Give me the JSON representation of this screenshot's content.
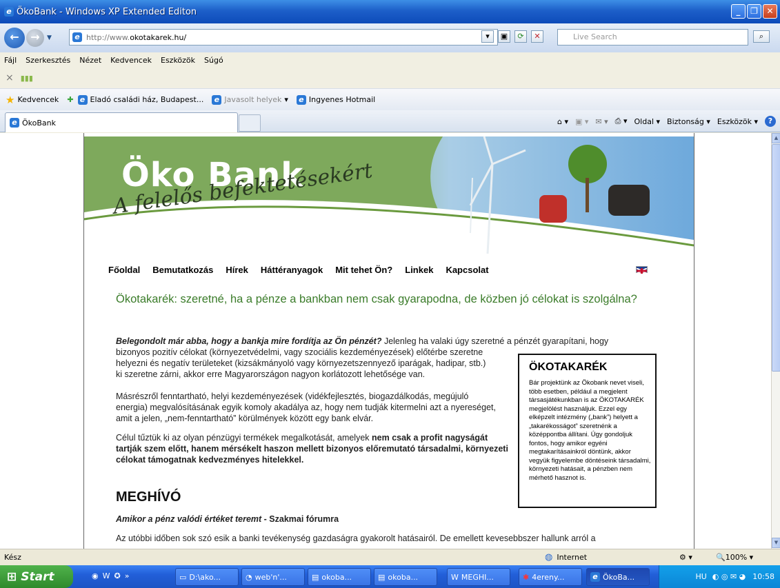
{
  "window": {
    "title": "ÖkoBank - Windows XP Extended Editon"
  },
  "address": {
    "prefix": "http://www.",
    "domain": "okotakarek.hu/",
    "search_placeholder": "Live Search"
  },
  "menu": [
    "Fájl",
    "Szerkesztés",
    "Nézet",
    "Kedvencek",
    "Eszközök",
    "Súgó"
  ],
  "favorites": {
    "label": "Kedvencek",
    "items": [
      "Eladó családi ház, Budapest...",
      "Javasolt helyek",
      "Ingyenes Hotmail"
    ]
  },
  "tab": {
    "label": "ÖkoBank"
  },
  "commandbar": {
    "page": "Oldal",
    "safety": "Biztonság",
    "tools": "Eszközök"
  },
  "site": {
    "brand": "Öko Bank",
    "slogan": "A felelős befektetésekért",
    "nav": [
      "Főoldal",
      "Bemutatkozás",
      "Hírek",
      "Háttéranyagok",
      "Mit tehet Ön?",
      "Linkek",
      "Kapcsolat"
    ],
    "headline": "Ökotakarék: szeretné, ha a pénze a bankban nem csak gyarapodna, de közben jó célokat is szolgálna?",
    "p1_bold": "Belegondolt már abba, hogy a bankja mire fordítja az Ön pénzét?",
    "p1_rest1": " Jelenleg ha valaki úgy szeretné a pénzét gyarapítani, hogy",
    "p1_line2": "bizonyos pozitív célokat (környezetvédelmi, vagy szociális kezdeményezések) előtérbe szeretne",
    "p1_line3": "helyezni és negatív területeket (kizsákmányoló vagy környezetszennyező iparágak, hadipar, stb.)",
    "p1_line4": "ki szeretne zárni, akkor erre Magyarországon nagyon korlátozott lehetősége van.",
    "p2": "Másrészről fenntartható, helyi kezdeményezések (vidékfejlesztés, biogazdálkodás, megújuló energia) megvalósításának egyik komoly akadálya az, hogy nem tudják kitermelni azt a nyereséget, amit a jelen, „nem-fenntartható” körülmények között egy bank elvár.",
    "p3_a": "Célul tűztük ki az olyan pénzügyi termékek megalkotását, amelyek ",
    "p3_b": "nem csak a profit nagyságát tartják szem előtt, hanem mérsékelt haszon mellett bizonyos előremutató társadalmi, környezeti célokat támogatnak kedvezményes hitelekkel.",
    "box_title": "ÖKOTAKARÉK",
    "box_text": "Bár projektünk az Ökobank nevet viseli, több esetben, például a megjelent társasjátékunkban is az ÖKOTAKARÉK megjelölést használjuk. Ezzel egy elképzelt intézmény („bank”) helyett a „takarékosságot” szeretnénk a középpontba állítani. Úgy gondoljuk fontos, hogy amikor egyéni megtakarításainkról döntünk, akkor vegyük figyelembe döntéseink társadalmi, környezeti hatásait, a pénzben nem mérhető hasznot is.",
    "meghivo": "MEGHÍVÓ",
    "sub_italic": "Amikor a pénz valódi értéket teremt",
    "sub_rest": " - Szakmai fórumra",
    "p4": "Az utóbbi időben sok szó esik a banki tevékenység gazdaságra gyakorolt hatásairól. De emellett kevesebbszer hallunk arról a"
  },
  "status": {
    "left": "Kész",
    "zone": "Internet",
    "zoom": "100%"
  },
  "taskbar": {
    "start": "Start",
    "items": [
      "D:\\ako...",
      "web'n'...",
      "okoba...",
      "okoba...",
      "MEGHI...",
      "4ereny...",
      "ÖkoBa..."
    ],
    "clock": "10:58",
    "lang": "HU"
  }
}
